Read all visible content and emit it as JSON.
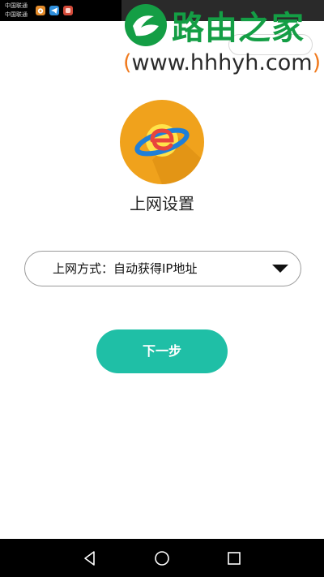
{
  "status_bar": {
    "carrier_1": "中国联通",
    "carrier_2": "中国联通",
    "icons": [
      "weibo-icon",
      "telegram-icon",
      "app-icon"
    ]
  },
  "watermark": {
    "title": "路由之家",
    "url": "www.hhhyh.com",
    "paren_open": "(",
    "paren_close": ")"
  },
  "page": {
    "title": "上网设置"
  },
  "connection": {
    "mode_label": "上网方式：自动获得IP地址"
  },
  "actions": {
    "next_label": "下一步"
  },
  "colors": {
    "accent": "#1fbfa6",
    "icon_orange": "#f0a21c",
    "watermark_green": "#149e45",
    "watermark_orange": "#f07a1e"
  }
}
